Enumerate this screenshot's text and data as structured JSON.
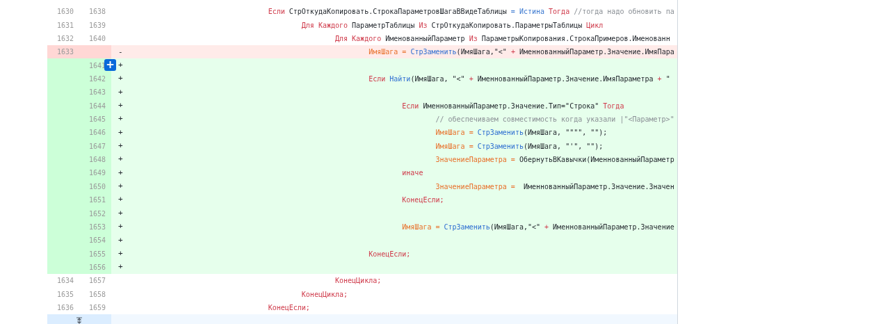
{
  "diff": {
    "rows": [
      {
        "kind": "context",
        "old": "1630",
        "new": "1638",
        "code": [
          {
            "kind": "kw",
            "text": "\t\t\t\tЕсли"
          },
          {
            "kind": "plain",
            "text": " СтрОткудаКопировать.СтрокаПараметровШагаВВидеТаблицы "
          },
          {
            "kind": "const",
            "text": "= Истина"
          },
          {
            "kind": "kw",
            "text": " Тогда"
          },
          {
            "kind": "comment",
            "text": " //тогда надо обновить па"
          }
        ]
      },
      {
        "kind": "context",
        "old": "1631",
        "new": "1639",
        "code": [
          {
            "kind": "kw",
            "text": "\t\t\t\t\tДля Каждого"
          },
          {
            "kind": "plain",
            "text": " ПараметрТаблицы "
          },
          {
            "kind": "kw",
            "text": "Из"
          },
          {
            "kind": "plain",
            "text": " СтрОткудаКопировать.ПараметрыТаблицы "
          },
          {
            "kind": "kw",
            "text": "Цикл"
          }
        ]
      },
      {
        "kind": "context",
        "old": "1632",
        "new": "1640",
        "code": [
          {
            "kind": "kw",
            "text": "\t\t\t\t\t\tДля Каждого"
          },
          {
            "kind": "plain",
            "text": " ИменованныйПараметр "
          },
          {
            "kind": "kw",
            "text": "Из"
          },
          {
            "kind": "plain",
            "text": " ПараметрыКопирования.СтрокаПримеров.Именованн"
          }
        ]
      },
      {
        "kind": "deleted",
        "old": "1633",
        "sign": "-",
        "code": [
          {
            "kind": "var",
            "text": "\t\t\t\t\t\t\tИмяШага = "
          },
          {
            "kind": "fn",
            "text": "СтрЗаменить"
          },
          {
            "kind": "plain",
            "text": "(ИмяШага,\"<\" "
          },
          {
            "kind": "op",
            "text": "+"
          },
          {
            "kind": "plain",
            "text": " ИменнованныйПараметр.Значение.ИмяПара"
          }
        ]
      },
      {
        "kind": "added",
        "new": "1641",
        "sign": "+",
        "comment_button": "+",
        "code": []
      },
      {
        "kind": "added",
        "new": "1642",
        "sign": "+",
        "code": [
          {
            "kind": "kw",
            "text": "\t\t\t\t\t\t\tЕсли"
          },
          {
            "kind": "fn",
            "text": " Найти"
          },
          {
            "kind": "plain",
            "text": "(ИмяШага, \"<\" "
          },
          {
            "kind": "op",
            "text": "+"
          },
          {
            "kind": "plain",
            "text": " ИменнованныйПараметр.Значение.ИмяПараметра "
          },
          {
            "kind": "op",
            "text": "+"
          },
          {
            "kind": "plain",
            "text": " \""
          }
        ]
      },
      {
        "kind": "added",
        "new": "1643",
        "sign": "+",
        "code": []
      },
      {
        "kind": "added",
        "new": "1644",
        "sign": "+",
        "code": [
          {
            "kind": "kw",
            "text": "\t\t\t\t\t\t\t\tЕсли"
          },
          {
            "kind": "plain",
            "text": " ИменнованныйПараметр.Значение.Тип=\"Строка\" "
          },
          {
            "kind": "kw",
            "text": "Тогда"
          }
        ]
      },
      {
        "kind": "added",
        "new": "1645",
        "sign": "+",
        "code": [
          {
            "kind": "comment",
            "text": "\t\t\t\t\t\t\t\t\t// обеспечиваем совместимость когда указали |\"<Параметр>\""
          }
        ]
      },
      {
        "kind": "added",
        "new": "1646",
        "sign": "+",
        "code": [
          {
            "kind": "var",
            "text": "\t\t\t\t\t\t\t\t\tИмяШага = "
          },
          {
            "kind": "fn",
            "text": "СтрЗаменить"
          },
          {
            "kind": "plain",
            "text": "(ИмяШага, \"\"\"\", \"\");"
          }
        ]
      },
      {
        "kind": "added",
        "new": "1647",
        "sign": "+",
        "code": [
          {
            "kind": "var",
            "text": "\t\t\t\t\t\t\t\t\tИмяШага = "
          },
          {
            "kind": "fn",
            "text": "СтрЗаменить"
          },
          {
            "kind": "plain",
            "text": "(ИмяШага, \"'\", \"\");"
          }
        ]
      },
      {
        "kind": "added",
        "new": "1648",
        "sign": "+",
        "code": [
          {
            "kind": "var",
            "text": "\t\t\t\t\t\t\t\t\tЗначениеПараметра = "
          },
          {
            "kind": "plain",
            "text": "ОбернутьВКавычки(ИменнованныйПараметр"
          }
        ]
      },
      {
        "kind": "added",
        "new": "1649",
        "sign": "+",
        "code": [
          {
            "kind": "kw",
            "text": "\t\t\t\t\t\t\t\tиначе"
          }
        ]
      },
      {
        "kind": "added",
        "new": "1650",
        "sign": "+",
        "code": [
          {
            "kind": "var",
            "text": "\t\t\t\t\t\t\t\t\tЗначениеПараметра = "
          },
          {
            "kind": "plain",
            "text": " ИменнованныйПараметр.Значение.Значен"
          }
        ]
      },
      {
        "kind": "added",
        "new": "1651",
        "sign": "+",
        "code": [
          {
            "kind": "kw",
            "text": "\t\t\t\t\t\t\t\tКонецЕсли;"
          }
        ]
      },
      {
        "kind": "added",
        "new": "1652",
        "sign": "+",
        "code": []
      },
      {
        "kind": "added",
        "new": "1653",
        "sign": "+",
        "code": [
          {
            "kind": "var",
            "text": "\t\t\t\t\t\t\t\tИмяШага = "
          },
          {
            "kind": "fn",
            "text": "СтрЗаменить"
          },
          {
            "kind": "plain",
            "text": "(ИмяШага,\"<\" "
          },
          {
            "kind": "op",
            "text": "+"
          },
          {
            "kind": "plain",
            "text": " ИменнованныйПараметр.Значение"
          }
        ]
      },
      {
        "kind": "added",
        "new": "1654",
        "sign": "+",
        "code": []
      },
      {
        "kind": "added",
        "new": "1655",
        "sign": "+",
        "code": [
          {
            "kind": "kw",
            "text": "\t\t\t\t\t\t\tКонецЕсли;"
          }
        ]
      },
      {
        "kind": "added",
        "new": "1656",
        "sign": "+",
        "code": []
      },
      {
        "kind": "context",
        "old": "1634",
        "new": "1657",
        "code": [
          {
            "kind": "kw",
            "text": "\t\t\t\t\t\tКонецЦикла;"
          }
        ]
      },
      {
        "kind": "context",
        "old": "1635",
        "new": "1658",
        "code": [
          {
            "kind": "kw",
            "text": "\t\t\t\t\tКонецЦикла;"
          }
        ]
      },
      {
        "kind": "context",
        "old": "1636",
        "new": "1659",
        "code": [
          {
            "kind": "kw",
            "text": "\t\t\t\tКонецЕсли;"
          }
        ]
      }
    ]
  }
}
